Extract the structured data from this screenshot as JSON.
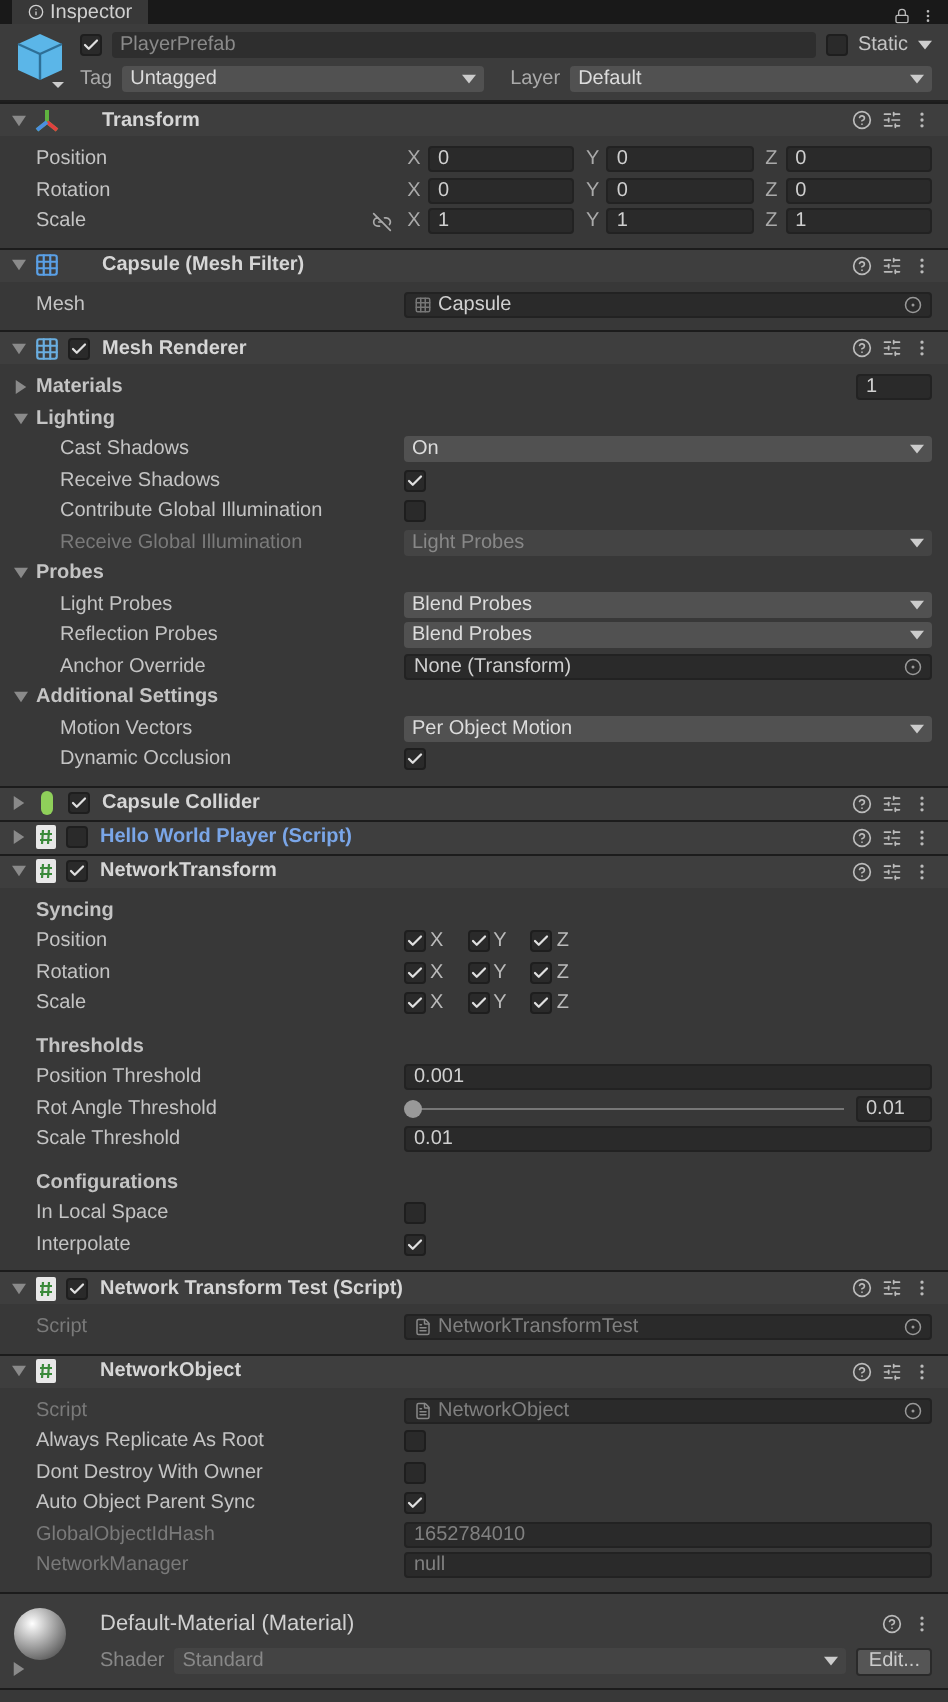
{
  "tab": {
    "title": "Inspector"
  },
  "object": {
    "active": true,
    "name": "PlayerPrefab",
    "static": false,
    "static_label": "Static",
    "tag_label": "Tag",
    "tag": "Untagged",
    "layer_label": "Layer",
    "layer": "Default"
  },
  "components": [
    {
      "kind": "transform",
      "title": "Transform",
      "expanded": true,
      "rows": [
        {
          "kind": "vector3",
          "label": "Position",
          "fields": [
            {
              "axis": "X",
              "value": "0"
            },
            {
              "axis": "Y",
              "value": "0"
            },
            {
              "axis": "Z",
              "value": "0"
            }
          ]
        },
        {
          "kind": "vector3",
          "label": "Rotation",
          "fields": [
            {
              "axis": "X",
              "value": "0"
            },
            {
              "axis": "Y",
              "value": "0"
            },
            {
              "axis": "Z",
              "value": "0"
            }
          ]
        },
        {
          "kind": "vector3",
          "label": "Scale",
          "proportional_toggle": true,
          "fields": [
            {
              "axis": "X",
              "value": "1"
            },
            {
              "axis": "Y",
              "value": "1"
            },
            {
              "axis": "Z",
              "value": "1"
            }
          ]
        }
      ]
    },
    {
      "kind": "mesh_filter",
      "title": "Capsule (Mesh Filter)",
      "expanded": true,
      "rows": [
        {
          "kind": "meshref",
          "label": "Mesh",
          "value": "Capsule"
        }
      ]
    },
    {
      "kind": "mesh_renderer",
      "title": "Mesh Renderer",
      "enabled": true,
      "expanded": true,
      "rows": [
        {
          "kind": "foldout",
          "label": "Materials",
          "expanded": false,
          "count": "1"
        },
        {
          "kind": "foldout",
          "label": "Lighting",
          "expanded": true,
          "children": [
            {
              "kind": "dropdown",
              "label": "Cast Shadows",
              "value": "On"
            },
            {
              "kind": "toggle",
              "label": "Receive Shadows",
              "checked": true
            },
            {
              "kind": "toggle",
              "label": "Contribute Global Illumination",
              "checked": false
            },
            {
              "kind": "dropdown",
              "label": "Receive Global Illumination",
              "value": "Light Probes",
              "disabled": true
            }
          ]
        },
        {
          "kind": "foldout",
          "label": "Probes",
          "expanded": true,
          "children": [
            {
              "kind": "dropdown",
              "label": "Light Probes",
              "value": "Blend Probes"
            },
            {
              "kind": "dropdown",
              "label": "Reflection Probes",
              "value": "Blend Probes"
            },
            {
              "kind": "object",
              "label": "Anchor Override",
              "value": "None (Transform)"
            }
          ]
        },
        {
          "kind": "foldout",
          "label": "Additional Settings",
          "expanded": true,
          "children": [
            {
              "kind": "dropdown",
              "label": "Motion Vectors",
              "value": "Per Object Motion"
            },
            {
              "kind": "toggle",
              "label": "Dynamic Occlusion",
              "checked": true
            }
          ]
        }
      ]
    },
    {
      "kind": "collider",
      "title": "Capsule Collider",
      "enabled": true,
      "expanded": false
    },
    {
      "kind": "script",
      "title": "Hello World Player (Script)",
      "enabled": false,
      "expanded": false,
      "overridden": true
    },
    {
      "kind": "script",
      "title": "NetworkTransform",
      "enabled": true,
      "expanded": true,
      "rows": [
        {
          "kind": "heading",
          "label": "Syncing"
        },
        {
          "kind": "axes",
          "label": "Position",
          "axes": [
            {
              "label": "X",
              "checked": true
            },
            {
              "label": "Y",
              "checked": true
            },
            {
              "label": "Z",
              "checked": true
            }
          ]
        },
        {
          "kind": "axes",
          "label": "Rotation",
          "axes": [
            {
              "label": "X",
              "checked": true
            },
            {
              "label": "Y",
              "checked": true
            },
            {
              "label": "Z",
              "checked": true
            }
          ]
        },
        {
          "kind": "axes",
          "label": "Scale",
          "axes": [
            {
              "label": "X",
              "checked": true
            },
            {
              "label": "Y",
              "checked": true
            },
            {
              "label": "Z",
              "checked": true
            }
          ]
        },
        {
          "kind": "heading",
          "label": "Thresholds"
        },
        {
          "kind": "text",
          "label": "Position Threshold",
          "value": "0.001"
        },
        {
          "kind": "slider",
          "label": "Rot Angle Threshold",
          "level": 0,
          "value": "0.01"
        },
        {
          "kind": "text",
          "label": "Scale Threshold",
          "value": "0.01"
        },
        {
          "kind": "heading",
          "label": "Configurations"
        },
        {
          "kind": "toggle",
          "label": "In Local Space",
          "checked": false
        },
        {
          "kind": "toggle",
          "label": "Interpolate",
          "checked": true
        }
      ]
    },
    {
      "kind": "script",
      "title": "Network Transform Test (Script)",
      "enabled": true,
      "expanded": true,
      "rows": [
        {
          "kind": "scriptref",
          "label": "Script",
          "value": "NetworkTransformTest",
          "disabled": true
        }
      ]
    },
    {
      "kind": "script",
      "title": "NetworkObject",
      "expanded": true,
      "rows": [
        {
          "kind": "scriptref",
          "label": "Script",
          "value": "NetworkObject",
          "disabled": true
        },
        {
          "kind": "toggle",
          "label": "Always Replicate As Root",
          "checked": false
        },
        {
          "kind": "toggle",
          "label": "Dont Destroy With Owner",
          "checked": false
        },
        {
          "kind": "toggle",
          "label": "Auto Object Parent Sync",
          "checked": true
        },
        {
          "kind": "text",
          "label": "GlobalObjectIdHash",
          "value": "1652784010",
          "disabled": true
        },
        {
          "kind": "text",
          "label": "NetworkManager",
          "value": "null",
          "disabled": true
        }
      ]
    }
  ],
  "material": {
    "title": "Default-Material (Material)",
    "expanded": false,
    "shader_label": "Shader",
    "shader": "Standard",
    "edit_button": "Edit..."
  }
}
